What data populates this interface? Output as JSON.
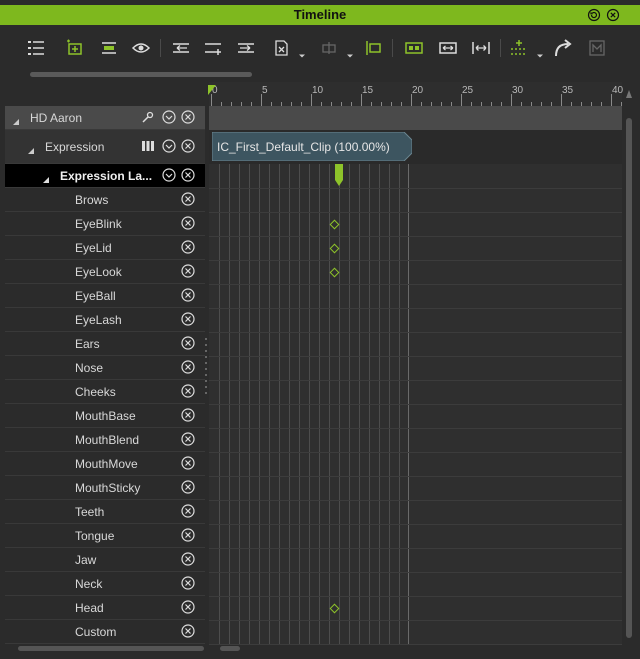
{
  "window": {
    "title": "Timeline"
  },
  "ruler": {
    "ticks": [
      "0",
      "5",
      "10",
      "15",
      "20",
      "25",
      "30",
      "35",
      "40"
    ]
  },
  "tracks": {
    "root": {
      "label": "HD Aaron"
    },
    "expression": {
      "label": "Expression"
    },
    "layer": {
      "label": "Expression La..."
    },
    "items": [
      {
        "label": "Brows"
      },
      {
        "label": "EyeBlink"
      },
      {
        "label": "EyeLid"
      },
      {
        "label": "EyeLook"
      },
      {
        "label": "EyeBall"
      },
      {
        "label": "EyeLash"
      },
      {
        "label": "Ears"
      },
      {
        "label": "Nose"
      },
      {
        "label": "Cheeks"
      },
      {
        "label": "MouthBase"
      },
      {
        "label": "MouthBlend"
      },
      {
        "label": "MouthMove"
      },
      {
        "label": "MouthSticky"
      },
      {
        "label": "Teeth"
      },
      {
        "label": "Tongue"
      },
      {
        "label": "Jaw"
      },
      {
        "label": "Neck"
      },
      {
        "label": "Head"
      },
      {
        "label": "Custom"
      }
    ]
  },
  "clip": {
    "label": "IC_First_Default_Clip (100.00%)"
  },
  "keyframes": {
    "frame": 12.5,
    "tracks": [
      "EyeBlink",
      "EyeLid",
      "EyeLook",
      "Head"
    ]
  },
  "colors": {
    "accent": "#7eb81e",
    "clip": "#3d5560",
    "key": "#8ec32a"
  }
}
